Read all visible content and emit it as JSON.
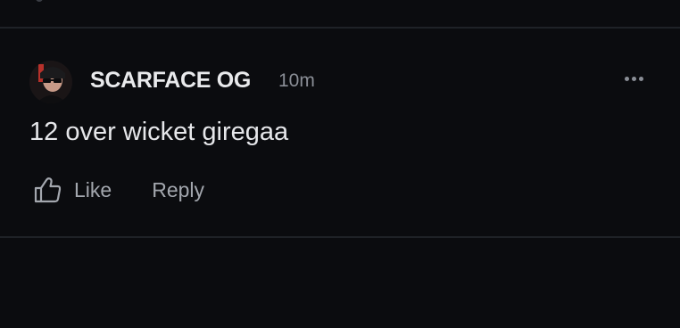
{
  "comment": {
    "author": "SCARFACE OG",
    "timestamp": "10m",
    "text": "12 over wicket giregaa",
    "avatar_icon": "profile-avatar-icon",
    "more_icon": "more-options-icon",
    "actions": {
      "like_label": "Like",
      "like_icon": "thumbs-up-icon",
      "reply_label": "Reply"
    }
  },
  "colors": {
    "background": "#0b0c0f",
    "divider": "#1f2227",
    "author": "#e9eaec",
    "muted": "#8a8e96",
    "action": "#a3a7ae"
  }
}
